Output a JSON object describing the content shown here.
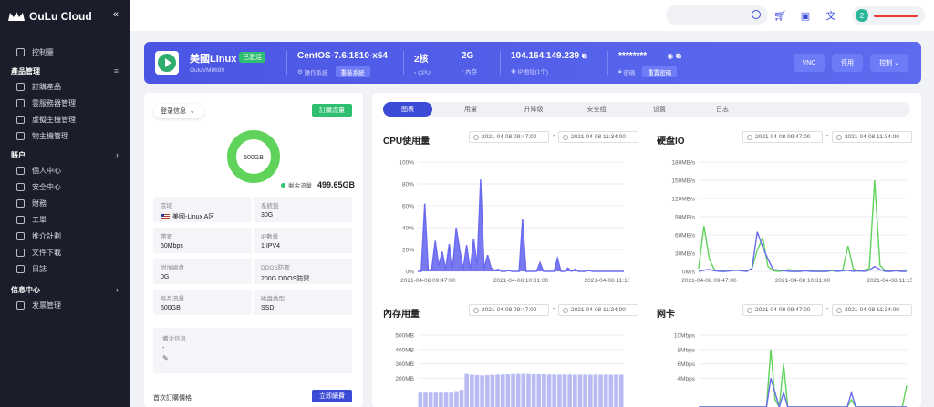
{
  "brand": {
    "name": "OuLu Cloud",
    "collapse": "«"
  },
  "sidebar": {
    "dashboard": "控制臺",
    "groups": [
      {
        "label": "產品管理",
        "items": [
          "訂購產品",
          "雲服務器管理",
          "虛擬主機管理",
          "物主機管理"
        ]
      },
      {
        "label": "賬户",
        "items": [
          "個人中心",
          "安全中心",
          "財務",
          "工單",
          "推介計劃",
          "文件下載",
          "日誌"
        ]
      },
      {
        "label": "信息中心",
        "items": [
          "发票管理"
        ]
      }
    ]
  },
  "topbar": {
    "user_badge": "2"
  },
  "server": {
    "name": "美國Linux",
    "status": "已激活",
    "id": "OuluVM8699",
    "os": "CentOS-7.6.1810-x64",
    "os_label": "操作系統",
    "reinstall": "重裝系統",
    "cpu": "2核",
    "cpu_label": "CPU",
    "mem": "2G",
    "mem_label": "內存",
    "ip": "104.164.149.239",
    "ip_label": "IP地址(1个)",
    "password": "********",
    "password_label": "密碼",
    "reset_password": "重置密碼",
    "vnc": "VNC",
    "stop": "停用",
    "control": "控制"
  },
  "left": {
    "select_label": "登录信息",
    "buy_traffic": "訂購流量",
    "donut_center": "500GB",
    "remain_label": "剩余流量",
    "remain_value": "499.65GB",
    "cells": [
      {
        "k": "區域",
        "v": "美國-Linux A区",
        "flag": true
      },
      {
        "k": "系統盤",
        "v": "30G"
      },
      {
        "k": "帶寬",
        "v": "50Mbps"
      },
      {
        "k": "IP數量",
        "v": "1 IPV4"
      },
      {
        "k": "附加磁盘",
        "v": "0G"
      },
      {
        "k": "DDOS防禦",
        "v": "200G DDOS防禦"
      },
      {
        "k": "每月流量",
        "v": "500GB"
      },
      {
        "k": "磁盘类型",
        "v": "SSD"
      }
    ],
    "note_label": "備注信息",
    "note_value": "-",
    "note_edit": "✎",
    "renew_label": "首次訂購價格",
    "renew_button": "立即續費"
  },
  "tabs": [
    "图表",
    "用量",
    "升降级",
    "安全组",
    "设置",
    "日志"
  ],
  "date_range": {
    "start": "2021-04-08 09:47:00",
    "end": "2021-04-08 11:34:00",
    "sep": "-"
  },
  "colors": {
    "blue": "#3c4ad8",
    "series_blue": "#6a6af0",
    "series_green": "#5fd35a",
    "green": "#2fbf71"
  },
  "chart_data": [
    {
      "type": "area",
      "title": "CPU使用量",
      "ylim": [
        0,
        100
      ],
      "yticks": [
        "0%",
        "20%",
        "40%",
        "60%",
        "80%",
        "100%"
      ],
      "xticks": [
        "2021-04-08 09:47:00",
        "2021-04-08 10:31:00",
        "2021-04-08 11:15:00"
      ],
      "series": [
        {
          "values": [
            0,
            0,
            62,
            1,
            2,
            28,
            5,
            18,
            2,
            25,
            3,
            40,
            20,
            2,
            24,
            1,
            30,
            5,
            84,
            2,
            15,
            3,
            1,
            2,
            0,
            0,
            1,
            0,
            0,
            0,
            48,
            0,
            0,
            0,
            0,
            8,
            0,
            0,
            0,
            0,
            12,
            0,
            0,
            3,
            0,
            2,
            0,
            0,
            0,
            1,
            0,
            0,
            0,
            0,
            0,
            0,
            0,
            0,
            0,
            0
          ]
        }
      ]
    },
    {
      "type": "line",
      "title": "硬盘IO",
      "ylim": [
        0,
        180
      ],
      "yticks": [
        "0M/s",
        "30MB/s",
        "60MB/s",
        "90MB/s",
        "120MB/s",
        "150MB/s",
        "180MB/s"
      ],
      "xticks": [
        "2021-04-08 09:47:00",
        "2021-04-08 10:31:00",
        "2021-04-08 11:15:00"
      ],
      "series": [
        {
          "values": [
            5,
            75,
            20,
            2,
            1,
            0,
            1,
            2,
            1,
            0,
            5,
            35,
            55,
            8,
            1,
            0,
            1,
            3,
            0,
            0,
            2,
            1,
            0,
            0,
            0,
            1,
            0,
            1,
            42,
            4,
            0,
            2,
            5,
            150,
            10,
            1,
            0,
            2,
            0,
            3
          ]
        },
        {
          "values": [
            0,
            2,
            3,
            1,
            0,
            0,
            1,
            2,
            1,
            0,
            5,
            65,
            40,
            20,
            3,
            2,
            1,
            0,
            0,
            0,
            1,
            0,
            0,
            0,
            0,
            2,
            0,
            1,
            2,
            0,
            1,
            0,
            2,
            8,
            3,
            0,
            0,
            1,
            0,
            0
          ]
        }
      ]
    },
    {
      "type": "bar",
      "title": "內存用量",
      "ylim": [
        0,
        500
      ],
      "yticks": [
        "200MB",
        "300MB",
        "400MB",
        "500MB"
      ],
      "series": [
        {
          "values": [
            100,
            100,
            100,
            100,
            100,
            100,
            100,
            110,
            120,
            230,
            225,
            222,
            220,
            222,
            224,
            226,
            226,
            228,
            230,
            230,
            230,
            230,
            228,
            228,
            228,
            226,
            226,
            226,
            226,
            226,
            225,
            225,
            225,
            225,
            225,
            225,
            225,
            225,
            225,
            225
          ]
        }
      ]
    },
    {
      "type": "line",
      "title": "网卡",
      "ylim": [
        0,
        10
      ],
      "yticks": [
        "4Mbps",
        "6Mbps",
        "8Mbps",
        "10Mbps"
      ],
      "series": [
        {
          "values": [
            0,
            0,
            0,
            0,
            0,
            0,
            0,
            0,
            0,
            0,
            0,
            0,
            0,
            0,
            0,
            0,
            0,
            8,
            1,
            0,
            6,
            0,
            0,
            0,
            0,
            0,
            0,
            0,
            0,
            0,
            0,
            0,
            0,
            0,
            0,
            0,
            1,
            0,
            0,
            0,
            0,
            0,
            0,
            0,
            0,
            0,
            0,
            0,
            0,
            3
          ]
        },
        {
          "values": [
            0,
            0,
            0,
            0,
            0,
            0,
            0,
            0,
            0,
            0,
            0,
            0,
            0,
            0,
            0,
            0,
            0,
            4,
            2,
            0,
            2,
            0,
            0,
            0,
            0,
            0,
            0,
            0,
            0,
            0,
            0,
            0,
            0,
            0,
            0,
            0,
            2,
            0,
            0,
            0,
            0,
            0,
            0,
            0,
            0,
            0,
            0,
            0,
            0,
            0
          ]
        }
      ]
    }
  ]
}
